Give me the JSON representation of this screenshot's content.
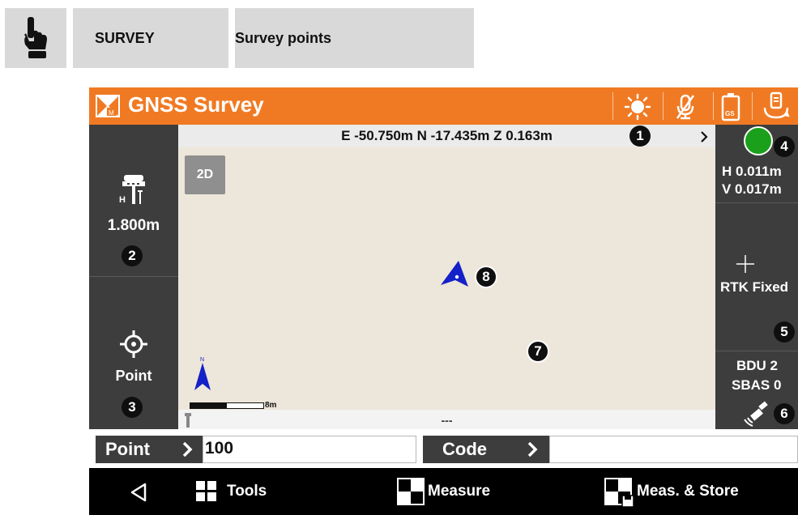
{
  "doc_header": {
    "section": "SURVEY",
    "topic": "Survey points"
  },
  "app": {
    "title": "GNSS Survey",
    "status_icons": [
      "sun-icon",
      "mic-off-icon",
      "battery-icon",
      "receiver-icon"
    ],
    "battery_label": "GS",
    "coordinates": "E -50.750m N -17.435m Z 0.163m",
    "left_panel": {
      "antenna_height": "1.800m",
      "antenna_h_label": "H",
      "mode_label": "Point"
    },
    "right_panel": {
      "precision_h": "H 0.011m",
      "precision_v": "V 0.017m",
      "solution": "RTK Fixed",
      "satellites_line1": "BDU 2",
      "satellites_line2": "SBAS 0",
      "status_color": "#1aa01a"
    },
    "map": {
      "view_mode": "2D",
      "scale_label": "8m",
      "bottom_status": "---"
    },
    "inputs": {
      "point_label": "Point",
      "point_value": "100",
      "code_label": "Code",
      "code_value": ""
    },
    "nav": {
      "tools": "Tools",
      "measure": "Measure",
      "meas_store": "Meas. & Store"
    },
    "accent_color": "#f07a23"
  },
  "callouts": {
    "c1": "1",
    "c2": "2",
    "c3": "3",
    "c4": "4",
    "c5": "5",
    "c6": "6",
    "c7": "7",
    "c8": "8"
  }
}
